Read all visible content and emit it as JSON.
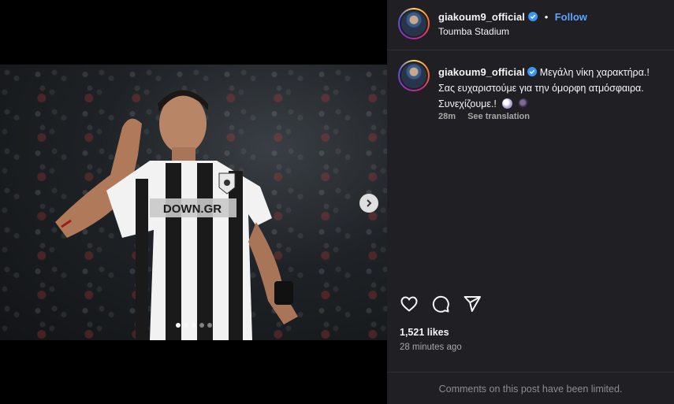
{
  "post": {
    "username": "giakoum9_official",
    "follow_label": "Follow",
    "separator": "•",
    "location": "Toumba Stadium",
    "caption_line1": "Μεγάλη νίκη χαρακτήρα.!",
    "caption_line2": "Σας ευχαριστούμε για την όμορφη ατμόσφαιρα.",
    "caption_line3": "Συνεχίζουμε.!",
    "time_short": "28m",
    "see_translation": "See translation",
    "likes": "1,521 likes",
    "time_ago": "28 minutes ago",
    "comments_limited": "Comments on this post have been limited.",
    "jersey_sponsor": "DOWN.GR"
  },
  "carousel": {
    "slide_count": 5,
    "active_index": 0
  },
  "colors": {
    "accent": "#5fa4ff",
    "verified": "#3897f0",
    "panel_bg": "#1f1f24"
  },
  "icons": [
    "verified-badge-icon",
    "chevron-right-icon",
    "heart-icon",
    "comment-icon",
    "share-icon"
  ]
}
